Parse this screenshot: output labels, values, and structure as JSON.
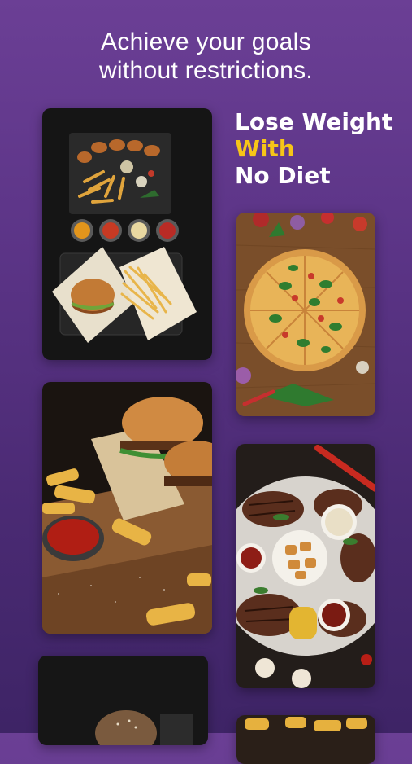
{
  "header": {
    "line1": "Achieve your goals",
    "line2": "without restrictions."
  },
  "promo": {
    "line1": "Lose Weight",
    "line2": "With",
    "line3": "No Diet",
    "accent_color": "#f6c518"
  },
  "colors": {
    "background_top": "#6b3f95",
    "background_bottom": "#3e2466",
    "text": "#ffffff"
  },
  "gallery": [
    {
      "name": "chicken-fries-burger-photo"
    },
    {
      "name": "pizza-photo"
    },
    {
      "name": "burger-fries-photo"
    },
    {
      "name": "grilled-meat-platter-photo"
    },
    {
      "name": "burger-photo-partial"
    },
    {
      "name": "fries-photo-partial"
    }
  ]
}
